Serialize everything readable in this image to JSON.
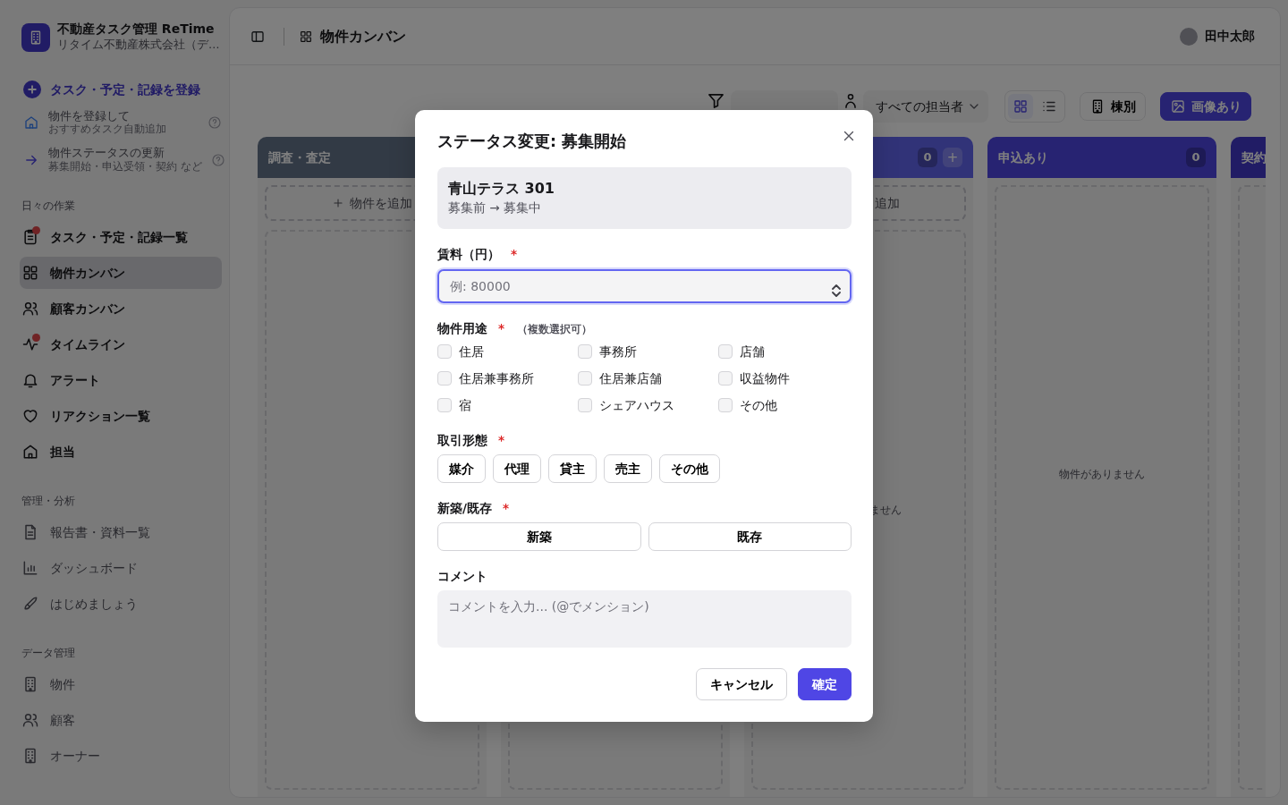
{
  "sidebar": {
    "app_title": "不動産タスク管理 ReTime",
    "company": "リタイム不動産株式会社（デ…",
    "register_action": "タスク・予定・記録を登録",
    "helpers": [
      {
        "title": "物件を登録して",
        "subtitle": "おすすめタスク自動追加"
      },
      {
        "title": "物件ステータスの更新",
        "subtitle": "募集開始・申込受領・契約 など"
      }
    ],
    "sections": [
      {
        "heading": "日々の作業",
        "items": [
          {
            "label": "タスク・予定・記録一覧",
            "selected": false,
            "dot": true
          },
          {
            "label": "物件カンバン",
            "selected": true,
            "dot": false
          },
          {
            "label": "顧客カンバン",
            "selected": false,
            "dot": false
          },
          {
            "label": "タイムライン",
            "selected": false,
            "dot": true
          },
          {
            "label": "アラート",
            "selected": false,
            "dot": false
          },
          {
            "label": "リアクション一覧",
            "selected": false,
            "dot": false
          },
          {
            "label": "担当",
            "selected": false,
            "dot": false
          }
        ]
      },
      {
        "heading": "管理・分析",
        "items": [
          {
            "label": "報告書・資料一覧",
            "selected": false,
            "dot": false
          },
          {
            "label": "ダッシュボード",
            "selected": false,
            "dot": false
          },
          {
            "label": "はじめましょう",
            "selected": false,
            "dot": false
          }
        ]
      },
      {
        "heading": "データ管理",
        "items": [
          {
            "label": "物件",
            "selected": false,
            "dot": false
          },
          {
            "label": "顧客",
            "selected": false,
            "dot": false
          },
          {
            "label": "オーナー",
            "selected": false,
            "dot": false
          }
        ]
      }
    ]
  },
  "header": {
    "page_title": "物件カンバン",
    "user": "田中太郎"
  },
  "toolbar": {
    "filters": [
      {
        "value": "すべての担当者"
      }
    ],
    "view_modes": [
      {
        "selected": true
      },
      {
        "selected": false
      }
    ],
    "toggles": [
      {
        "label": "棟別",
        "selected": false
      },
      {
        "label": "画像あり",
        "selected": true
      }
    ]
  },
  "columns": [
    {
      "kind": "stage",
      "name": "調査・査定",
      "add_label": "物件を追加"
    },
    {
      "kind": "drop_zone"
    },
    {
      "kind": "stage",
      "count": "0",
      "add_button": "+",
      "add_label": "追加",
      "empty_label": "ません"
    },
    {
      "kind": "stage",
      "name": "申込あり",
      "count": "0",
      "empty_label": "物件がありません"
    },
    {
      "kind": "stage",
      "name": "契約"
    }
  ],
  "dialog": {
    "title": "ステータス変更: 募集開始",
    "property": {
      "name": "青山テラス 301",
      "transition": "募集前 → 募集中"
    },
    "rent": {
      "label": "賃料（円）",
      "required": "*",
      "placeholder": "例: 80000",
      "focused": true
    },
    "usage": {
      "label": "物件用途",
      "required": "*",
      "hint": "（複数選択可）",
      "options": [
        {
          "label": "住居",
          "checked": false
        },
        {
          "label": "事務所",
          "checked": false
        },
        {
          "label": "店舗",
          "checked": false
        },
        {
          "label": "住居兼事務所",
          "checked": false
        },
        {
          "label": "住居兼店舗",
          "checked": false
        },
        {
          "label": "収益物件",
          "checked": false
        },
        {
          "label": "宿",
          "checked": false
        },
        {
          "label": "シェアハウス",
          "checked": false
        },
        {
          "label": "その他",
          "checked": false
        }
      ]
    },
    "deal_type": {
      "label": "取引形態",
      "required": "*",
      "options": [
        {
          "label": "媒介",
          "selected": false
        },
        {
          "label": "代理",
          "selected": false
        },
        {
          "label": "貸主",
          "selected": false
        },
        {
          "label": "売主",
          "selected": false
        },
        {
          "label": "その他",
          "selected": false
        }
      ]
    },
    "build": {
      "label": "新築/既存",
      "required": "*",
      "options": [
        {
          "label": "新築",
          "selected": false
        },
        {
          "label": "既存",
          "selected": false
        }
      ]
    },
    "comment": {
      "label": "コメント",
      "placeholder": "コメントを入力... (@でメンション)"
    },
    "buttons": [
      {
        "label": "キャンセル",
        "kind": "secondary"
      },
      {
        "label": "確定",
        "kind": "primary"
      }
    ]
  }
}
